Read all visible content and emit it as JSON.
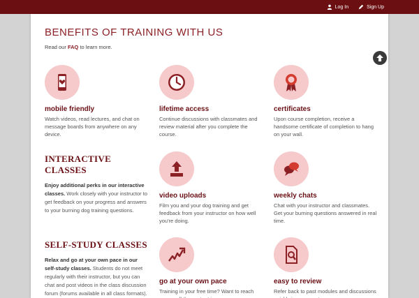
{
  "topbar": {
    "login_label": "Log In",
    "signup_label": "Sign Up"
  },
  "page": {
    "title": "BENEFITS OF TRAINING WITH US",
    "intro_prefix": "Read our ",
    "intro_link": "FAQ",
    "intro_suffix": " to learn more."
  },
  "features": {
    "mobile": {
      "title": "mobile friendly",
      "text": "Watch videos, read lectures, and chat on message boards from anywhere on any device.",
      "icon": "phone-heart-icon"
    },
    "lifetime": {
      "title": "lifetime access",
      "text": "Continue discussions with classmates and review material after you complete the course.",
      "icon": "clock-icon"
    },
    "certificates": {
      "title": "certificates",
      "text": "Upon course completion, receive a handsome certificate of completion to hang on your wall.",
      "icon": "award-ribbon-icon"
    },
    "uploads": {
      "title": "video uploads",
      "text": "Film you and your dog training and get feedback from your instructor on how well you're doing.",
      "icon": "upload-icon"
    },
    "chats": {
      "title": "weekly chats",
      "text": "Chat with your instructor and classmates. Get your burning questions answered in real time.",
      "icon": "chat-bubbles-icon"
    },
    "pace": {
      "title": "go at your own pace",
      "text": "Training in your free time? Want to reach course all the content in one",
      "icon": "trend-arrow-icon"
    },
    "review": {
      "title": "easy to review",
      "text": "Refer back to past modules and discussions quickly in our easy to use",
      "icon": "document-search-icon"
    }
  },
  "sections": {
    "interactive": {
      "title": "INTERACTIVE CLASSES",
      "bold": "Enjoy additional perks in our interactive classes.",
      "text": " Work closely with your instructor to get feedback on your progress and answers to your burning dog training questions."
    },
    "selfstudy": {
      "title": "SELF-STUDY CLASSES",
      "bold": "Relax and go at your own pace in our self-study classes.",
      "text": " Students do not meet regularly with their instructor, but you can chat and post videos in the class discussion forum (forums available in all class formats)."
    }
  },
  "colors": {
    "brand": "#6b0f12",
    "accent": "#8b2025",
    "icon_bg": "#f6c9cb"
  }
}
